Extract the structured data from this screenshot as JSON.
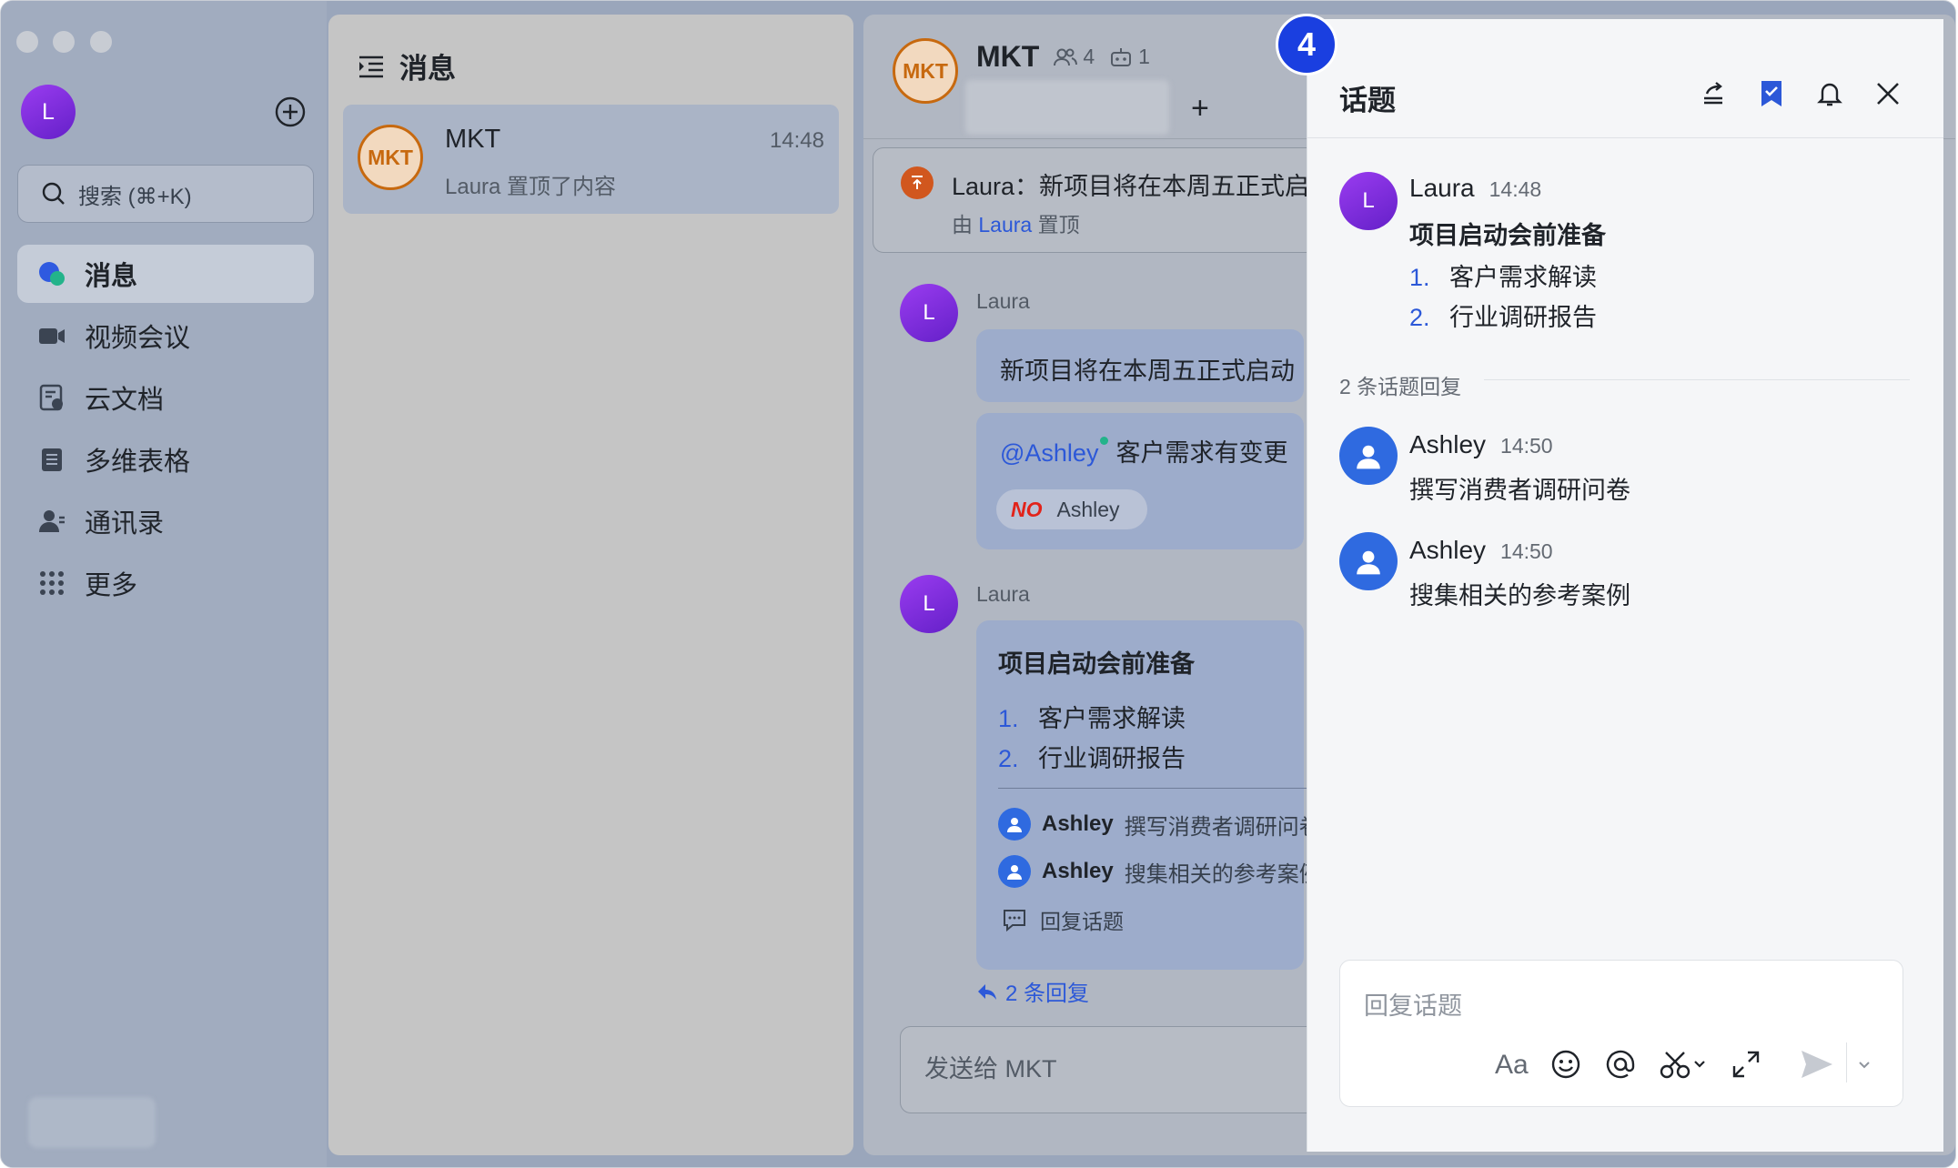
{
  "colors": {
    "accent": "#2c58d8",
    "sidebar_bg": "#a1acbf",
    "thread_bg": "#f5f6f8",
    "badge": "#1a3fe0",
    "mkt_orange": "#c7690f"
  },
  "sidebar": {
    "avatar_letter": "L",
    "search_placeholder": "搜索 (⌘+K)",
    "items": [
      {
        "label": "消息",
        "icon": "chat-bubble-icon",
        "active": true
      },
      {
        "label": "视频会议",
        "icon": "video-camera-icon"
      },
      {
        "label": "云文档",
        "icon": "cloud-doc-icon"
      },
      {
        "label": "多维表格",
        "icon": "table-icon"
      },
      {
        "label": "通讯录",
        "icon": "contacts-icon"
      },
      {
        "label": "更多",
        "icon": "grid-dots-icon"
      }
    ]
  },
  "list": {
    "title": "消息",
    "conversations": [
      {
        "avatar": "MKT",
        "name": "MKT",
        "time": "14:48",
        "preview": "Laura 置顶了内容"
      }
    ]
  },
  "chat": {
    "avatar": "MKT",
    "title": "MKT",
    "members": "4",
    "bots": "1",
    "add_tab": "+",
    "pinned": {
      "text": "Laura：新项目将在本周五正式启",
      "by_prefix": "由",
      "by_name": "Laura",
      "by_suffix": "置顶"
    },
    "messages": [
      {
        "sender": "Laura",
        "avatar": "L",
        "text": "新项目将在本周五正式启动",
        "mention": "@Ashley",
        "mention_text": "客户需求有变更",
        "tag": "NO",
        "tag_name": "Ashley"
      },
      {
        "sender": "Laura",
        "avatar": "L",
        "title": "项目启动会前准备",
        "items": [
          {
            "num": "1.",
            "text": "客户需求解读"
          },
          {
            "num": "2.",
            "text": "行业调研报告"
          }
        ],
        "replies": [
          {
            "name": "Ashley",
            "text": "撰写消费者调研问卷"
          },
          {
            "name": "Ashley",
            "text": "搜集相关的参考案例"
          }
        ],
        "reply_label": "回复话题",
        "reply_count": "2 条回复"
      }
    ],
    "input_placeholder": "发送给 MKT"
  },
  "thread": {
    "badge": "4",
    "title": "话题",
    "root": {
      "sender": "Laura",
      "avatar": "L",
      "time": "14:48",
      "title": "项目启动会前准备",
      "items": [
        {
          "num": "1.",
          "text": "客户需求解读"
        },
        {
          "num": "2.",
          "text": "行业调研报告"
        }
      ]
    },
    "divider": "2 条话题回复",
    "replies": [
      {
        "sender": "Ashley",
        "time": "14:50",
        "text": "撰写消费者调研问卷"
      },
      {
        "sender": "Ashley",
        "time": "14:50",
        "text": "搜集相关的参考案例"
      }
    ],
    "input_placeholder": "回复话题",
    "format_label": "Aa"
  }
}
